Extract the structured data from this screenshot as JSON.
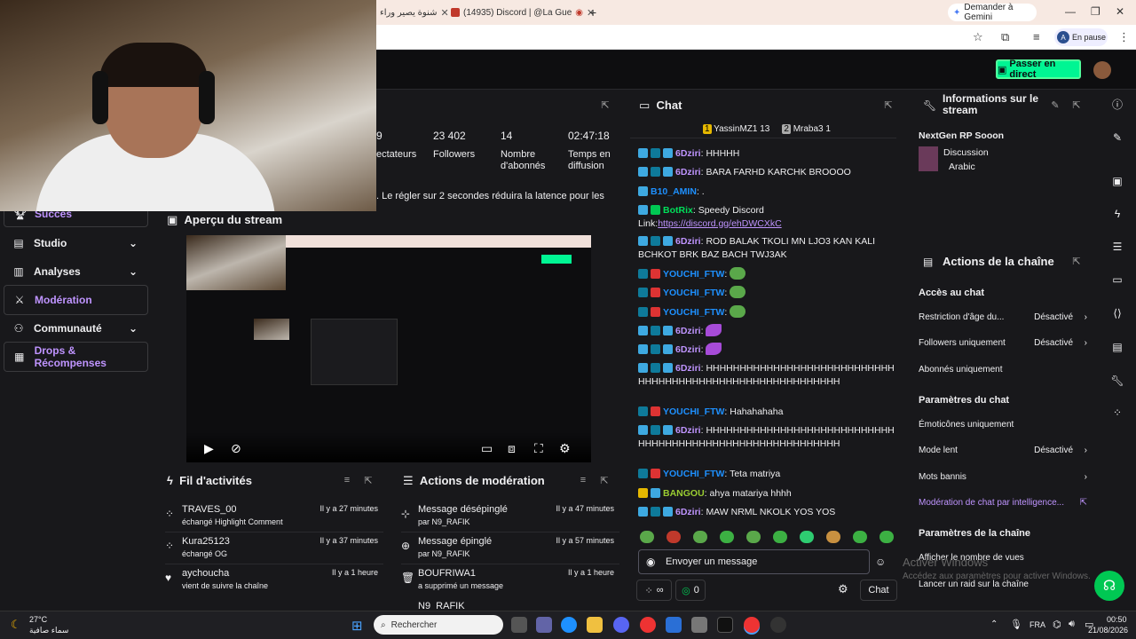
{
  "browser": {
    "tabs": [
      {
        "label": "شنوة يصير وراء",
        "active": false
      },
      {
        "label": "(14935) Discord | @La Gue",
        "active": false
      }
    ],
    "new_tab": "+",
    "gemini_label": "Demander à Gemini",
    "profile_initial": "A",
    "profile_status": "En pause"
  },
  "header": {
    "go_live": "Passer en direct",
    "go_live_color": "#00f593"
  },
  "nav": {
    "items": [
      {
        "label": "Succès",
        "icon": "trophy-icon",
        "active": true
      },
      {
        "label": "Studio",
        "icon": "studio-icon",
        "chevron": true
      },
      {
        "label": "Analyses",
        "icon": "chart-icon",
        "chevron": true
      },
      {
        "label": "Modération",
        "icon": "sword-icon",
        "active": true
      },
      {
        "label": "Communauté",
        "icon": "community-icon",
        "chevron": true
      },
      {
        "label": "Drops & Récompenses",
        "icon": "drops-icon",
        "active": true
      }
    ]
  },
  "stats": {
    "partial_num": "9",
    "partial_label": "ectateurs",
    "followers_num": "23 402",
    "followers_label": "Followers",
    "subs_num": "14",
    "subs_label": "Nombre d'abonnés",
    "time_num": "02:47:18",
    "time_label": "Temps en diffusion",
    "latency_note": ". Le régler sur 2 secondes réduira la latence pour les"
  },
  "preview": {
    "title": "Aperçu du stream"
  },
  "activity": {
    "title": "Fil d'activités",
    "items": [
      {
        "name": "TRAVES_00",
        "sub": "échangé Highlight Comment",
        "time": "Il y a 27 minutes",
        "icon": "points-icon"
      },
      {
        "name": "Kura25123",
        "sub": "échangé OG",
        "time": "Il y a 37 minutes",
        "icon": "points-icon"
      },
      {
        "name": "aychoucha",
        "sub": "vient de suivre la chaîne",
        "time": "Il y a 1 heure",
        "icon": "heart-icon"
      }
    ]
  },
  "modactions": {
    "title": "Actions de modération",
    "items": [
      {
        "name": "Message désépinglé",
        "sub": "par N9_RAFIK",
        "time": "Il y a 47 minutes",
        "icon": "unpin-icon"
      },
      {
        "name": "Message épinglé",
        "sub": "par N9_RAFIK",
        "time": "Il y a 57 minutes",
        "icon": "pin-icon"
      },
      {
        "name": "BOUFRIWA1",
        "sub": "a supprimé un message",
        "time": "Il y a 1 heure",
        "icon": "trash-icon"
      }
    ],
    "cut_row": "N9_RAFIK"
  },
  "chat": {
    "title": "Chat",
    "leaders": [
      {
        "rank": "1",
        "name": "YassinMZ1",
        "count": "13"
      },
      {
        "rank": "2",
        "name": "Mraba3",
        "count": "1"
      }
    ],
    "messages": [
      {
        "user": "6Dziri",
        "cls": "u-6",
        "text": "HHHHH"
      },
      {
        "user": "6Dziri",
        "cls": "u-6",
        "text": "BARA FARHD KARCHK BROOOO"
      },
      {
        "user": "B10_AMIN",
        "cls": "u-10",
        "text": "."
      },
      {
        "user": "BotRix",
        "cls": "u-b",
        "text": "Speedy Discord Link:",
        "link": "https://discord.gg/ehDWCXkC"
      },
      {
        "user": "6Dziri",
        "cls": "u-6",
        "text": "ROD BALAK TKOLI MN LJO3 KAN KALI BCHKOT BRK BAZ BACH TWJ3AK"
      },
      {
        "user": "YOUCHI_FTW",
        "cls": "u-y",
        "text": "",
        "emote": "frog"
      },
      {
        "user": "YOUCHI_FTW",
        "cls": "u-y",
        "text": "",
        "emote": "frog"
      },
      {
        "user": "YOUCHI_FTW",
        "cls": "u-y",
        "text": "",
        "emote": "frog"
      },
      {
        "user": "6Dziri",
        "cls": "u-6",
        "text": "",
        "emote": "wisp"
      },
      {
        "user": "6Dziri",
        "cls": "u-6",
        "text": "",
        "emote": "wisp"
      },
      {
        "user": "6Dziri",
        "cls": "u-6",
        "text": "HHHHHHHHHHHHHHHHHHHHHHHHHHHHHHHHHHHHHHHHHHHHHHHHHHHHHHHHHH"
      },
      {
        "user": "YOUCHI_FTW",
        "cls": "u-y",
        "text": "Hahahahaha"
      },
      {
        "user": "6Dziri",
        "cls": "u-6",
        "text": "HHHHHHHHHHHHHHHHHHHHHHHHHHHHHHHHHHHHHHHHHHHHHHHHHHHHHHHHHH"
      },
      {
        "user": "YOUCHI_FTW",
        "cls": "u-y",
        "text": "Teta matriya"
      },
      {
        "user": "BANGOU",
        "cls": "u-g",
        "text": "ahya matariya hhhh"
      },
      {
        "user": "6Dziri",
        "cls": "u-6",
        "text": "MAW NRML NKOLK YOS YOS"
      }
    ],
    "input_placeholder": "Envoyer un message",
    "points": "0",
    "send_label": "Chat"
  },
  "info": {
    "title": "Informations sur le stream",
    "stream_title": "NextGen RP Sooon",
    "category": "Discussion",
    "language": "Arabic"
  },
  "channel_actions": {
    "title": "Actions de la chaîne",
    "chat_access": "Accès au chat",
    "rows1": [
      {
        "label": "Restriction d'âge du...",
        "value": "Désactivé",
        "arrow": true
      },
      {
        "label": "Followers uniquement",
        "value": "Désactivé",
        "arrow": true
      },
      {
        "label": "Abonnés uniquement",
        "value": "",
        "arrow": false
      }
    ],
    "chat_params": "Paramètres du chat",
    "rows2": [
      {
        "label": "Émoticônes uniquement",
        "value": "",
        "arrow": false
      },
      {
        "label": "Mode lent",
        "value": "Désactivé",
        "arrow": true
      },
      {
        "label": "Mots bannis",
        "value": "",
        "arrow": true
      }
    ],
    "ai_mod": "Modération de chat par intelligence...",
    "channel_params": "Paramètres de la chaîne",
    "rows3": [
      "Afficher le nombre de vues",
      "Lancer un raid sur la chaîne"
    ]
  },
  "watermark": {
    "line1": "Activer Windows",
    "line2": "Accédez aux paramètres pour activer Windows."
  },
  "taskbar": {
    "temp": "27°C",
    "weather": "سماء صافية",
    "search": "Rechercher",
    "lang": "FRA",
    "time": "00:50",
    "date": "21/08/2026"
  }
}
